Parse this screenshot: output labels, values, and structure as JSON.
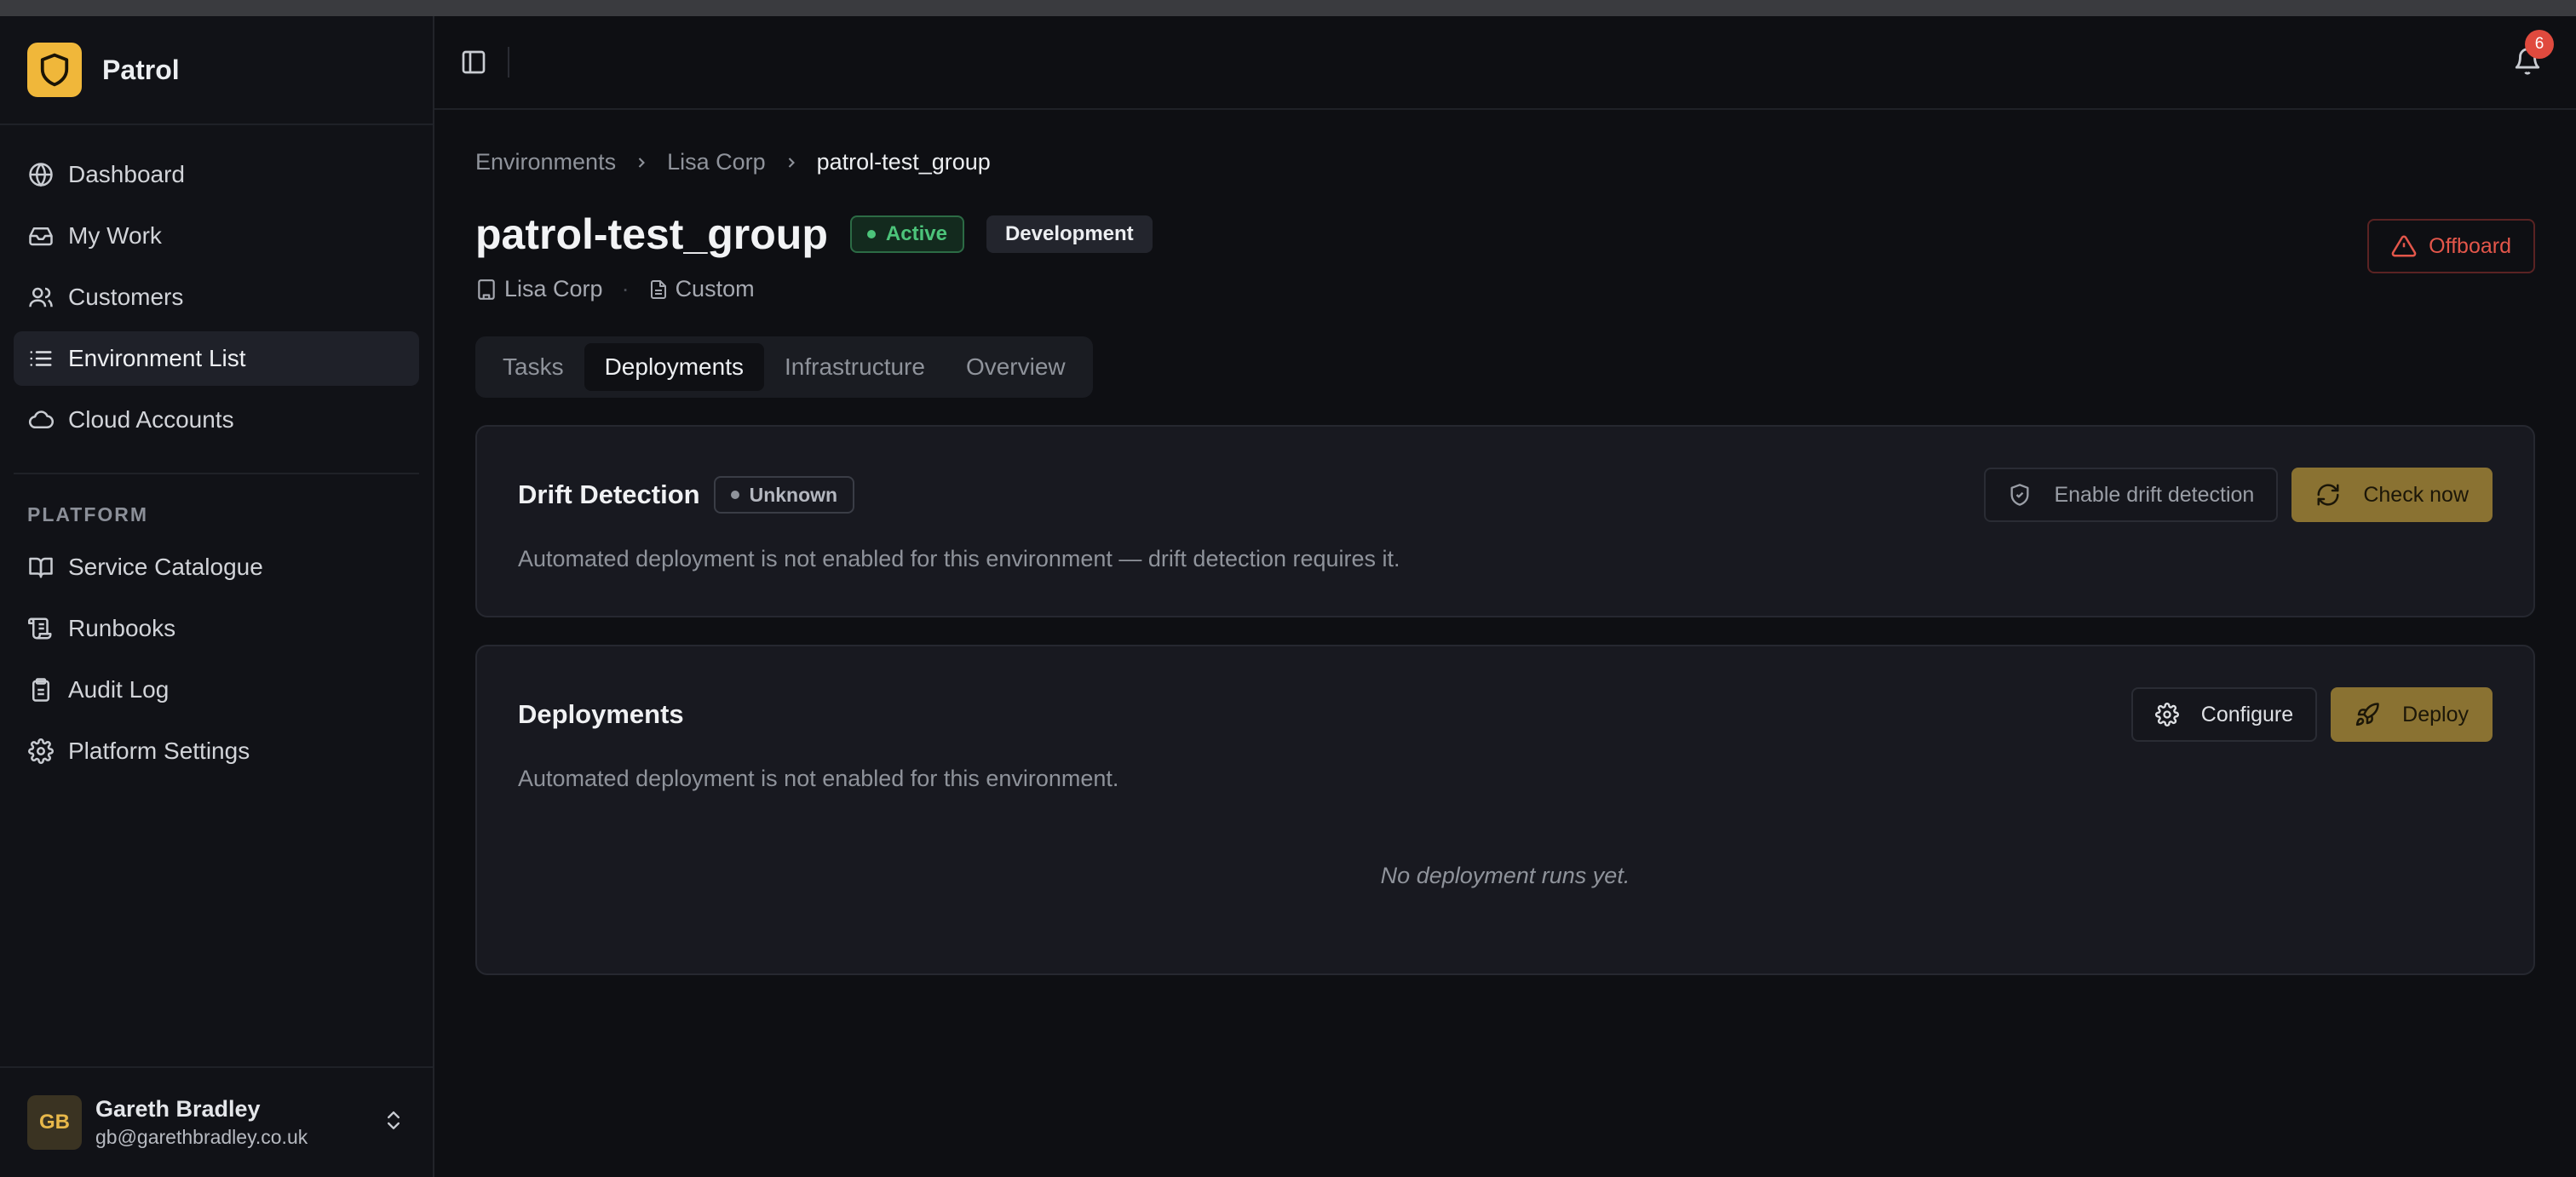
{
  "app": {
    "name": "Patrol"
  },
  "sidebar": {
    "items": [
      {
        "label": "Dashboard",
        "icon": "globe-icon"
      },
      {
        "label": "My Work",
        "icon": "inbox-icon"
      },
      {
        "label": "Customers",
        "icon": "users-icon"
      },
      {
        "label": "Environment List",
        "icon": "list-icon",
        "active": true
      },
      {
        "label": "Cloud Accounts",
        "icon": "cloud-icon"
      }
    ],
    "platform_label": "PLATFORM",
    "platform_items": [
      {
        "label": "Service Catalogue",
        "icon": "book-icon"
      },
      {
        "label": "Runbooks",
        "icon": "scroll-icon"
      },
      {
        "label": "Audit Log",
        "icon": "clipboard-icon"
      },
      {
        "label": "Platform Settings",
        "icon": "gear-icon"
      }
    ]
  },
  "user": {
    "initials": "GB",
    "name": "Gareth Bradley",
    "email": "gb@garethbradley.co.uk"
  },
  "header": {
    "notification_count": "6"
  },
  "breadcrumb": [
    "Environments",
    "Lisa Corp",
    "patrol-test_group"
  ],
  "page": {
    "title": "patrol-test_group",
    "status": "Active",
    "environment": "Development",
    "customer": "Lisa Corp",
    "template": "Custom",
    "offboard_label": "Offboard"
  },
  "tabs": [
    {
      "label": "Tasks"
    },
    {
      "label": "Deployments",
      "active": true
    },
    {
      "label": "Infrastructure"
    },
    {
      "label": "Overview"
    }
  ],
  "drift": {
    "title": "Drift Detection",
    "status": "Unknown",
    "description": "Automated deployment is not enabled for this environment — drift detection requires it.",
    "enable_label": "Enable drift detection",
    "check_label": "Check now"
  },
  "deployments": {
    "title": "Deployments",
    "description": "Automated deployment is not enabled for this environment.",
    "configure_label": "Configure",
    "deploy_label": "Deploy",
    "empty_text": "No deployment runs yet."
  },
  "colors": {
    "accent": "#f0b73a",
    "gold_button": "#8a7232",
    "active_green": "#4cc47a",
    "danger": "#e3564a"
  }
}
